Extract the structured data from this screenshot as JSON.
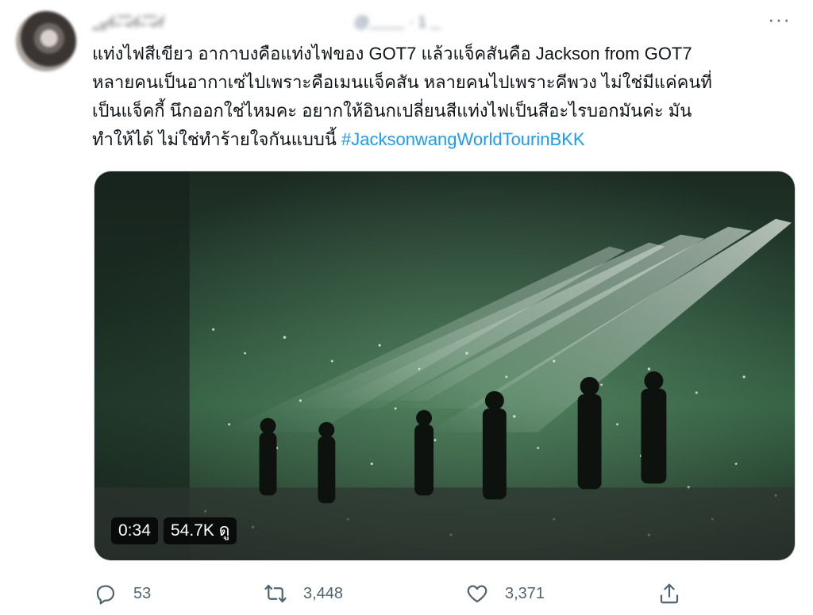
{
  "tweet": {
    "author_name": "ˍ͟ ",
    "author_handle": "",
    "more_label": "···",
    "text_lines": [
      "แท่งไฟสีเขียว อากาบงคือแท่งไฟของ GOT7 แล้วแจ็คสันคือ Jackson from GOT7",
      "หลายคนเป็นอากาเซ่ไปเพราะคือเมนแจ็คสัน หลายคนไปเพราะคีพวง ไม่ใช่มีแค่คนที่",
      "เป็นแจ็คกี้ นึกออกใช่ไหมคะ อยากให้อินกเปลี่ยนสีแท่งไฟเป็นสีอะไรบอกมันค่ะ มัน"
    ],
    "text_last_line": "ทำให้ได้ ไม่ใช่ทำร้ายใจกันแบบนี้ ",
    "hashtag": "#JacksonwangWorldTourinBKK"
  },
  "media": {
    "duration": "0:34",
    "views": "54.7K ดู"
  },
  "actions": {
    "replies": "53",
    "retweets": "3,448",
    "likes": "3,371"
  },
  "colors": {
    "link": "#1d9bf0",
    "muted": "#536471",
    "text": "#0f1419"
  }
}
